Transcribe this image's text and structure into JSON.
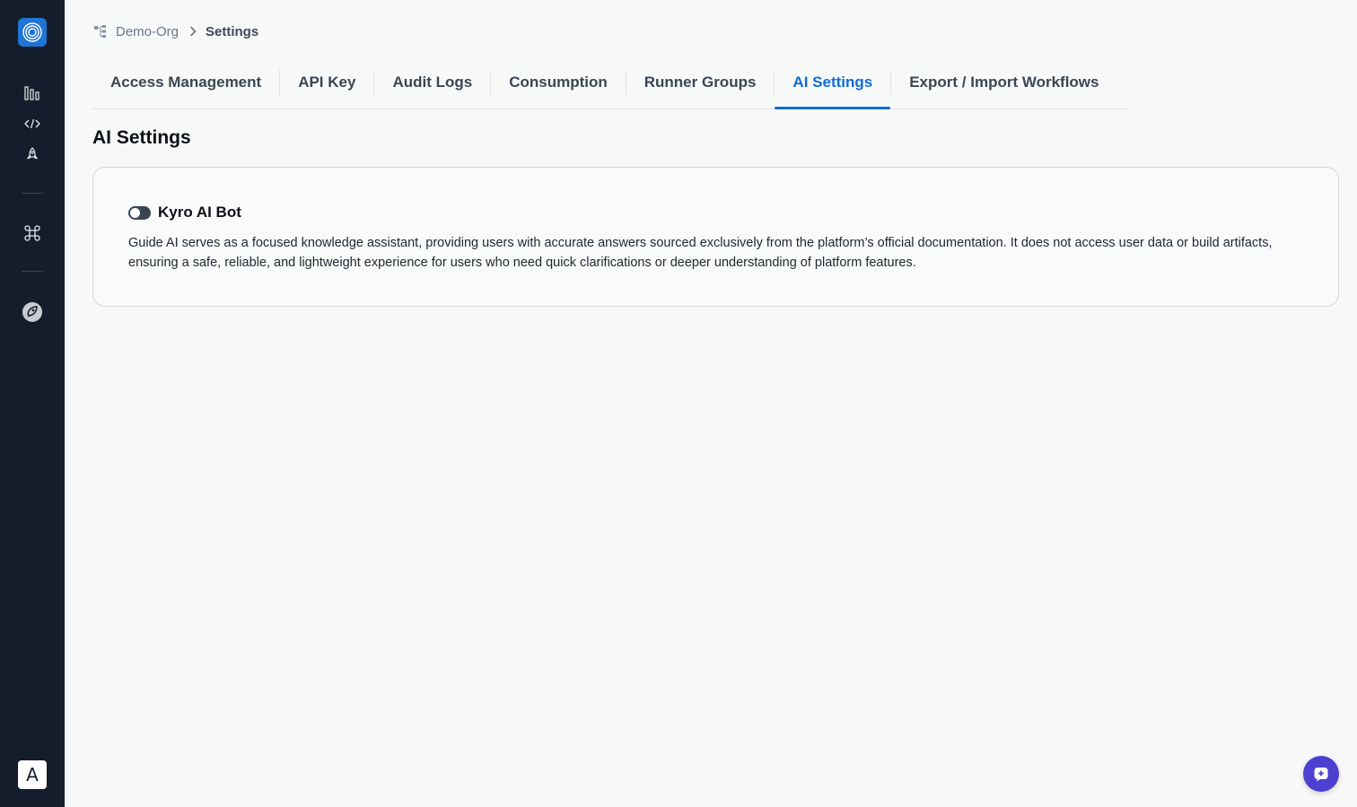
{
  "sidebar": {
    "logo_icon": "concentric-circles-logo",
    "nav_items": [
      {
        "name": "dashboard",
        "icon": "bar-chart-icon"
      },
      {
        "name": "workflows",
        "icon": "code-icon"
      },
      {
        "name": "deployments",
        "icon": "rocket-icon"
      },
      {
        "name": "commands",
        "icon": "command-icon"
      },
      {
        "name": "settings",
        "icon": "settings-gear-icon"
      }
    ],
    "user_initial": "A"
  },
  "breadcrumb": {
    "org": "Demo-Org",
    "current": "Settings"
  },
  "tabs": [
    {
      "label": "Access Management",
      "active": false
    },
    {
      "label": "API Key",
      "active": false
    },
    {
      "label": "Audit Logs",
      "active": false
    },
    {
      "label": "Consumption",
      "active": false
    },
    {
      "label": "Runner Groups",
      "active": false
    },
    {
      "label": "AI Settings",
      "active": true
    },
    {
      "label": "Export / Import Workflows",
      "active": false
    }
  ],
  "page": {
    "title": "AI Settings"
  },
  "card": {
    "title": "Kyro AI Bot",
    "toggle_on": false,
    "description": "Guide AI serves as a focused knowledge assistant, providing users with accurate answers sourced exclusively from the platform’s official documentation. It does not access user data or build artifacts, ensuring a safe, reliable, and lightweight experience for users who need quick clarifications or deeper understanding of platform features."
  },
  "fab": {
    "icon": "chat-plus-icon"
  },
  "colors": {
    "sidebar_bg": "#141d2b",
    "accent": "#0f6bd7",
    "fab": "#4d3fcf"
  }
}
